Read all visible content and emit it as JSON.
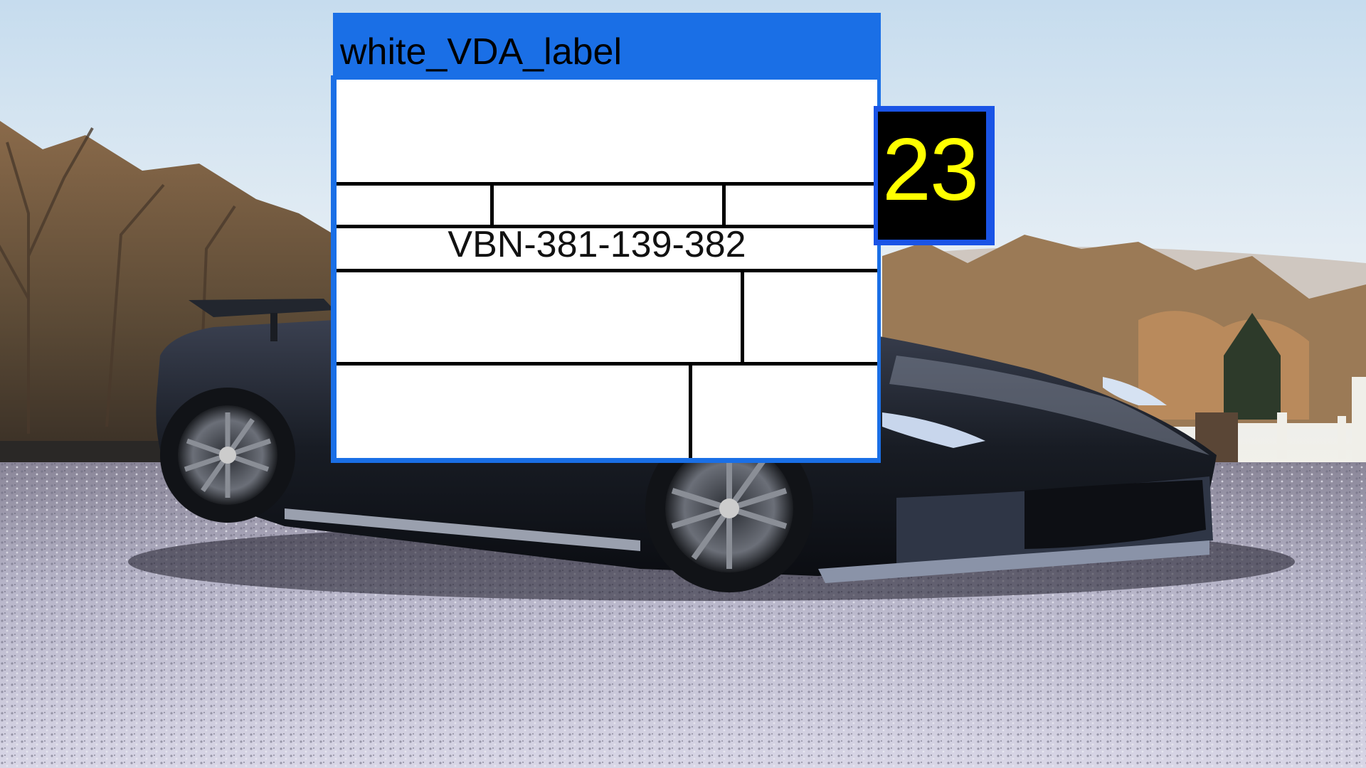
{
  "detection": {
    "label": "white_VDA_label",
    "box_color": "#1a6fe6"
  },
  "vda_label": {
    "number": "VBN-381-139-382"
  },
  "score_badge": {
    "text": "23",
    "text_color": "#ffff00",
    "background": "#000000",
    "border_color": "#1a54e6"
  }
}
